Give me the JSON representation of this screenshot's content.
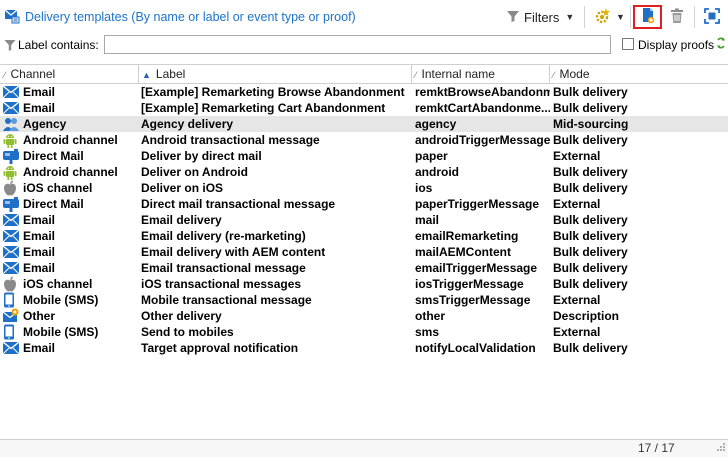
{
  "toolbar": {
    "title": "Delivery templates (By name or label or event type or proof)",
    "filters_label": "Filters",
    "icons": [
      "delivery-template-icon",
      "funnel-icon",
      "new-gear-icon",
      "new-template-icon",
      "trash-icon",
      "fullscreen-icon"
    ]
  },
  "filterbar": {
    "label": "Label contains:",
    "value": "",
    "display_proofs_label": "Display proofs",
    "display_proofs_checked": false
  },
  "columns": {
    "channel": "Channel",
    "label": "Label",
    "internal": "Internal name",
    "mode": "Mode"
  },
  "rows": [
    {
      "channel": "Email",
      "label": "[Example] Remarketing Browse Abandonment",
      "internal": "remktBrowseAbandonm",
      "mode": "Bulk delivery",
      "icon": "email"
    },
    {
      "channel": "Email",
      "label": "[Example] Remarketing Cart Abandonment",
      "internal": "remktCartAbandonme...",
      "mode": "Bulk delivery",
      "icon": "email"
    },
    {
      "channel": "Agency",
      "label": "Agency delivery",
      "internal": "agency",
      "mode": "Mid-sourcing",
      "icon": "agency"
    },
    {
      "channel": "Android channel",
      "label": "Android transactional message",
      "internal": "androidTriggerMessage",
      "mode": "Bulk delivery",
      "icon": "android"
    },
    {
      "channel": "Direct Mail",
      "label": "Deliver by direct mail",
      "internal": "paper",
      "mode": "External",
      "icon": "directmail"
    },
    {
      "channel": "Android channel",
      "label": "Deliver on Android",
      "internal": "android",
      "mode": "Bulk delivery",
      "icon": "android"
    },
    {
      "channel": "iOS channel",
      "label": "Deliver on iOS",
      "internal": "ios",
      "mode": "Bulk delivery",
      "icon": "ios"
    },
    {
      "channel": "Direct Mail",
      "label": "Direct mail transactional message",
      "internal": "paperTriggerMessage",
      "mode": "External",
      "icon": "directmail"
    },
    {
      "channel": "Email",
      "label": "Email delivery",
      "internal": "mail",
      "mode": "Bulk delivery",
      "icon": "email"
    },
    {
      "channel": "Email",
      "label": "Email delivery (re-marketing)",
      "internal": "emailRemarketing",
      "mode": "Bulk delivery",
      "icon": "email"
    },
    {
      "channel": "Email",
      "label": "Email delivery with AEM content",
      "internal": "mailAEMContent",
      "mode": "Bulk delivery",
      "icon": "email"
    },
    {
      "channel": "Email",
      "label": "Email transactional message",
      "internal": "emailTriggerMessage",
      "mode": "Bulk delivery",
      "icon": "email"
    },
    {
      "channel": "iOS channel",
      "label": "iOS transactional messages",
      "internal": "iosTriggerMessage",
      "mode": "Bulk delivery",
      "icon": "ios"
    },
    {
      "channel": "Mobile (SMS)",
      "label": "Mobile transactional message",
      "internal": "smsTriggerMessage",
      "mode": "External",
      "icon": "mobile"
    },
    {
      "channel": "Other",
      "label": "Other delivery",
      "internal": "other",
      "mode": "Description",
      "icon": "other"
    },
    {
      "channel": "Mobile (SMS)",
      "label": "Send to mobiles",
      "internal": "sms",
      "mode": "External",
      "icon": "mobile"
    },
    {
      "channel": "Email",
      "label": "Target approval notification",
      "internal": "notifyLocalValidation",
      "mode": "Bulk delivery",
      "icon": "email"
    }
  ],
  "selected_row": 2,
  "status": {
    "count": "17 / 17"
  },
  "colors": {
    "title": "#1e73c8",
    "icon_blue": "#1f6fc6",
    "android_green": "#8fbf2f",
    "highlight_border": "#e02020",
    "selected_row": "#e6e6e6"
  }
}
